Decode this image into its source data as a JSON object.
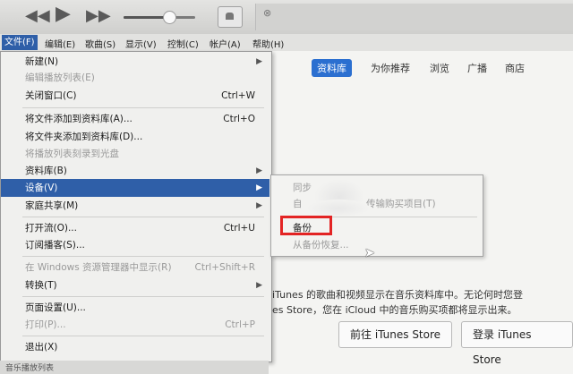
{
  "player": {
    "volume_level": 0.62,
    "now_playing_close": "⊗"
  },
  "menubar": {
    "items": [
      "文件(F)",
      "编辑(E)",
      "歌曲(S)",
      "显示(V)",
      "控制(C)",
      "帐户(A)",
      "帮助(H)"
    ]
  },
  "file_menu": {
    "new": {
      "label": "新建(N)"
    },
    "edit_playlist": {
      "label": "编辑播放列表(E)"
    },
    "close_window": {
      "label": "关闭窗口(C)",
      "shortcut": "Ctrl+W"
    },
    "add_file": {
      "label": "将文件添加到资料库(A)...",
      "shortcut": "Ctrl+O"
    },
    "add_folder": {
      "label": "将文件夹添加到资料库(D)..."
    },
    "burn_playlist": {
      "label": "将播放列表刻录到光盘"
    },
    "library": {
      "label": "资料库(B)"
    },
    "devices": {
      "label": "设备(V)"
    },
    "home_sharing": {
      "label": "家庭共享(M)"
    },
    "open_stream": {
      "label": "打开流(O)...",
      "shortcut": "Ctrl+U"
    },
    "subscribe_podcast": {
      "label": "订阅播客(S)..."
    },
    "show_in_explorer": {
      "label": "在 Windows 资源管理器中显示(R)",
      "shortcut": "Ctrl+Shift+R"
    },
    "convert": {
      "label": "转换(T)"
    },
    "page_setup": {
      "label": "页面设置(U)..."
    },
    "print": {
      "label": "打印(P)...",
      "shortcut": "Ctrl+P"
    },
    "exit": {
      "label": "退出(X)"
    }
  },
  "device_submenu": {
    "sync": "同步",
    "transfer_purchases": "自",
    "transfer_suffix": "传输购买项目(T)",
    "backup": "备份",
    "restore": "从备份恢复..."
  },
  "nav": {
    "tabs": [
      "资料库",
      "为你推荐",
      "浏览",
      "广播",
      "商店"
    ],
    "active": "资料库"
  },
  "main": {
    "desc_line1": "iTunes 的歌曲和视频显示在音乐资料库中。无论何时您登",
    "desc_line2": "es Store，您在 iCloud 中的音乐购买项都将显示出来。",
    "goto_store": "前往 iTunes Store",
    "signin_store": "登录 iTunes Store"
  },
  "bottom": {
    "text": "音乐播放列表"
  },
  "colors": {
    "menu_highlight": "#2f5fa8",
    "accent_tab": "#2b6fd0",
    "annotation_box": "#e32424"
  }
}
